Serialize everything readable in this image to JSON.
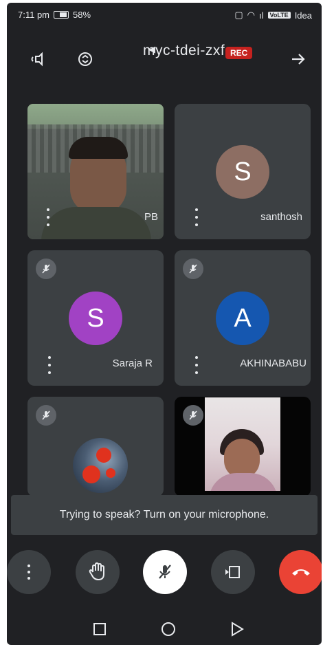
{
  "status_bar": {
    "time": "7:11 pm",
    "battery": "58%",
    "carrier_badge": "VoLTE",
    "carrier": "Idea"
  },
  "header": {
    "meeting_code": "myc-tdei-zxf",
    "rec_label": "REC"
  },
  "participants": [
    {
      "name": "PB",
      "video": true,
      "muted": false
    },
    {
      "name": "santhosh",
      "initial": "S",
      "avatar_color": "#8d6e63",
      "muted": false
    },
    {
      "name": "Saraja R",
      "initial": "S",
      "avatar_color": "#a142c4",
      "muted": true
    },
    {
      "name": "AKHINABABU",
      "initial": "A",
      "avatar_color": "#1557b0",
      "muted": true
    },
    {
      "name": "",
      "picture": true,
      "muted": true
    },
    {
      "name": "",
      "video": true,
      "muted": true
    }
  ],
  "toast": {
    "message": "Trying to speak? Turn on your microphone."
  },
  "icons": {
    "speaker": "speaker-icon",
    "switch_camera": "switch-camera-icon",
    "back": "back-arrow-icon",
    "more": "more-options-icon",
    "raise_hand": "raise-hand-icon",
    "mic_off": "mic-off-icon",
    "present": "present-screen-icon",
    "end_call": "end-call-icon"
  },
  "colors": {
    "background": "#202124",
    "tile": "#3c4043",
    "rec": "#c5221f",
    "end_call": "#ea4335"
  }
}
